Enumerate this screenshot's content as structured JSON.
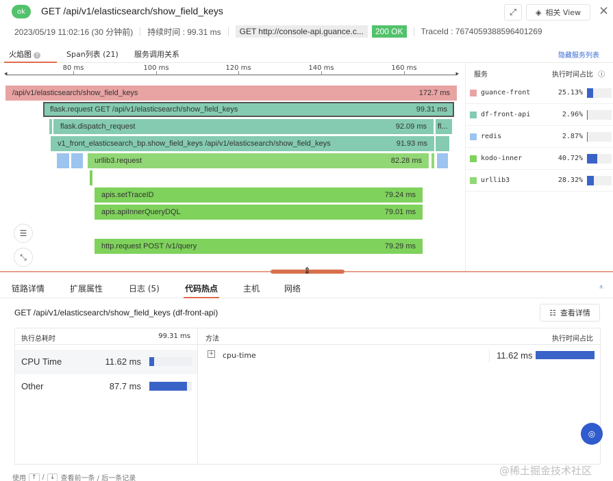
{
  "header": {
    "status": "ok",
    "title": "GET /api/v1/elasticsearch/show_field_keys",
    "related_view_label": "相关 View"
  },
  "meta": {
    "datetime": "2023/05/19 11:02:16 (30 分钟前)",
    "duration": "持续时间 : 99.31 ms",
    "url": "GET  http://console-api.guance.c...",
    "status_code": "200 OK",
    "trace_id": "TraceId : 7674059388596401269"
  },
  "tabs": {
    "flame": "火焰图",
    "span_list": "Span列表 (21)",
    "service_relation": "服务调用关系",
    "hide_service_list": "隐藏服务列表"
  },
  "ruler": {
    "ticks": [
      "80 ms",
      "100 ms",
      "120 ms",
      "140 ms",
      "160 ms"
    ]
  },
  "spans": [
    {
      "label": "/api/v1/elasticsearch/show_field_keys",
      "duration": "172.7 ms",
      "service": "guance-front"
    },
    {
      "label": "flask.request GET /api/v1/elasticsearch/show_field_keys",
      "duration": "99.31 ms",
      "service": "df-front-api"
    },
    {
      "label": "flask.dispatch_request",
      "duration": "92.09 ms",
      "service": "df-front-api"
    },
    {
      "label": "fl...",
      "duration": "",
      "service": "df-front-api"
    },
    {
      "label": "v1_front_elasticsearch_bp.show_field_keys /api/v1/elasticsearch/show_field_keys",
      "duration": "91.93 ms",
      "service": "df-front-api"
    },
    {
      "label": "urllib3.request",
      "duration": "82.28 ms",
      "service": "urllib3"
    },
    {
      "label": "apis.setTraceID",
      "duration": "79.24 ms",
      "service": "kodo-inner"
    },
    {
      "label": "apis.apiInnerQueryDQL",
      "duration": "79.01 ms",
      "service": "kodo-inner"
    },
    {
      "label": "http.request POST /v1/query",
      "duration": "79.29 ms",
      "service": "kodo-inner"
    }
  ],
  "services": {
    "header_service": "服务",
    "header_ratio": "执行时间占比",
    "items": [
      {
        "name": "guance-front",
        "percent": "25.13%",
        "ratio": 0.2513,
        "color": "#e8a3a3"
      },
      {
        "name": "df-front-api",
        "percent": "2.96%",
        "ratio": 0.0296,
        "color": "#84cbb1"
      },
      {
        "name": "redis",
        "percent": "2.87%",
        "ratio": 0.0287,
        "color": "#9cc4ee"
      },
      {
        "name": "kodo-inner",
        "percent": "40.72%",
        "ratio": 0.4072,
        "color": "#7fd25c"
      },
      {
        "name": "urllib3",
        "percent": "28.32%",
        "ratio": 0.2832,
        "color": "#92d775"
      }
    ]
  },
  "detail_tabs": [
    "链路详情",
    "扩展属性",
    "日志 (5)",
    "代码热点",
    "主机",
    "网络"
  ],
  "detail": {
    "title": "GET /api/v1/elasticsearch/show_field_keys (df-front-api)",
    "view_detail_label": "查看详情",
    "total_label": "执行总耗时",
    "total_value": "99.31 ms",
    "rows": [
      {
        "label": "CPU Time",
        "value": "11.62 ms",
        "ratio": 0.117
      },
      {
        "label": "Other",
        "value": "87.7 ms",
        "ratio": 0.883
      }
    ],
    "method_header": "方法",
    "ratio_header": "执行时间占比",
    "method": {
      "name": "cpu-time",
      "value": "11.62 ms",
      "ratio": 1.0
    }
  },
  "footer": {
    "hint_prefix": "使用",
    "key_up": "↑",
    "key_down": "↓",
    "hint_suffix": "查看前一条 / 后一条记录"
  },
  "watermark": "@稀土掘金技术社区"
}
